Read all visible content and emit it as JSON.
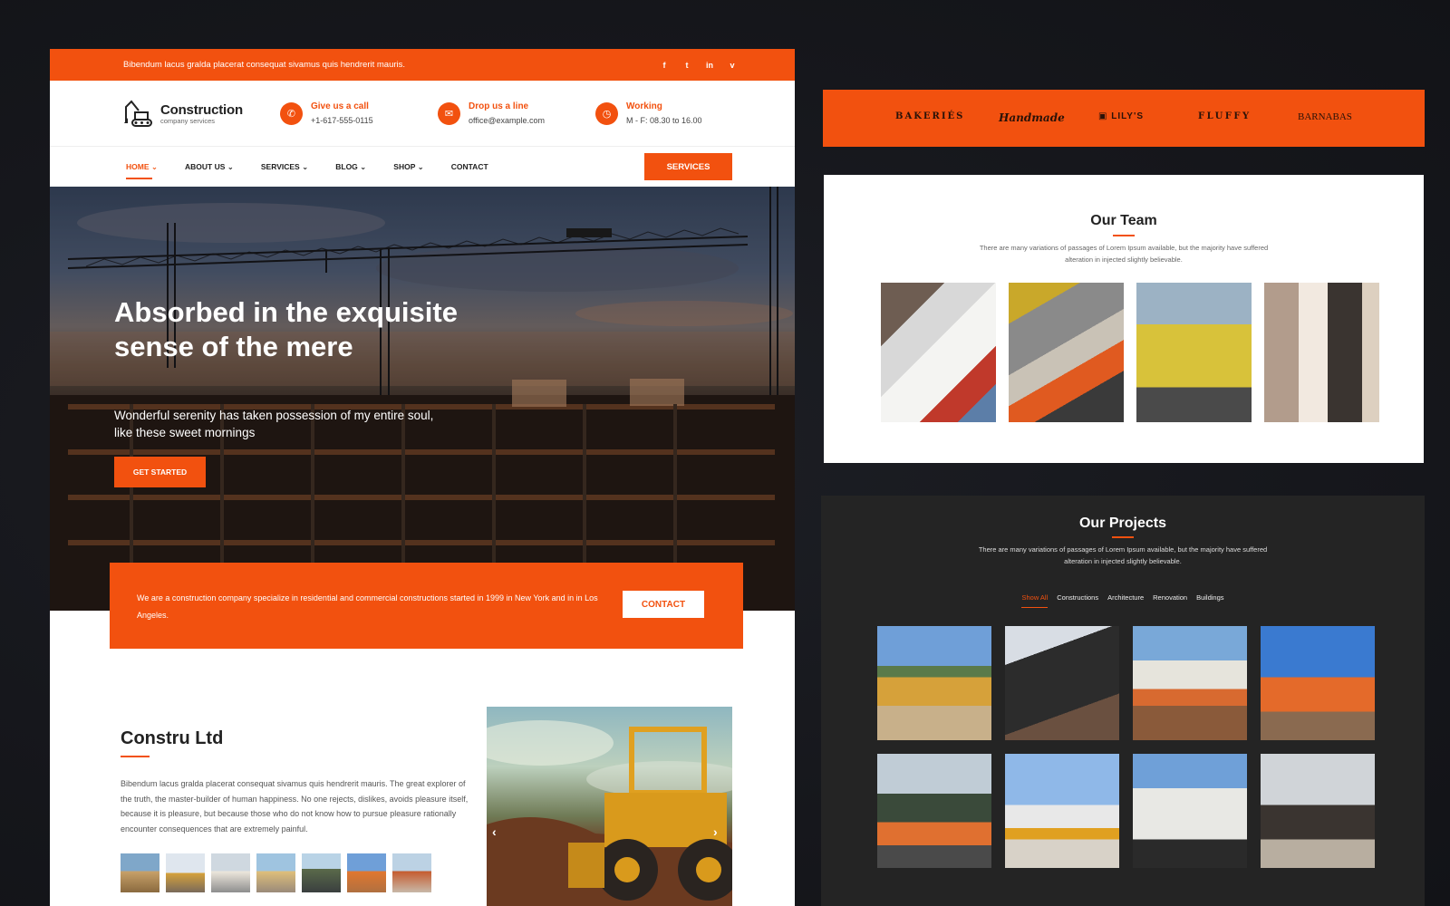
{
  "colors": {
    "accent": "#f2510f",
    "dark_bg": "#16171c",
    "projects_bg": "#242424"
  },
  "topbar": {
    "text": "Bibendum lacus gralda placerat consequat sivamus quis hendrerit mauris.",
    "socials": [
      "f",
      "t",
      "in",
      "v"
    ],
    "social_icons": [
      "facebook-icon",
      "twitter-icon",
      "linkedin-icon",
      "vimeo-icon"
    ]
  },
  "header": {
    "logo_title": "Construction",
    "logo_subtitle": "company services",
    "info": [
      {
        "icon": "phone-icon",
        "label": "Give us a call",
        "value": "+1-617-555-0115"
      },
      {
        "icon": "mail-icon",
        "label": "Drop us a line",
        "value": "office@example.com"
      },
      {
        "icon": "clock-icon",
        "label": "Working",
        "value": "M - F: 08.30 to 16.00"
      }
    ]
  },
  "nav": {
    "items": [
      "HOME",
      "ABOUT US",
      "SERVICES",
      "BLOG",
      "SHOP",
      "CONTACT"
    ],
    "services_button": "SERVICES"
  },
  "hero": {
    "title": "Absorbed in the exquisite sense of the mere",
    "subtitle": "Wonderful serenity has taken possession of my entire soul, like these sweet mornings",
    "button": "GET STARTED"
  },
  "cta": {
    "text": "We are a construction company specialize in residential and commercial constructions  started in 1999 in New York and in in Los Angeles.",
    "button": "CONTACT"
  },
  "about": {
    "title": "Constru Ltd",
    "text": "Bibendum lacus gralda placerat consequat sivamus quis hendrerit mauris. The great explorer of the truth, the master-builder of human happiness. No one rejects, dislikes, avoids pleasure itself, because it is pleasure, but because those who do not know how to pursue pleasure rationally encounter consequences that are extremely painful."
  },
  "brands": [
    "BAKERIÉS",
    "Handmade",
    "LILY'S",
    "FLUFFY",
    "BARNABAS"
  ],
  "team": {
    "title": "Our Team",
    "description": "There are many variations of passages of Lorem Ipsum available, but the majority have suffered alteration in injected slightly believable."
  },
  "projects": {
    "title": "Our Projects",
    "description": "There are many variations of passages of Lorem Ipsum available, but the majority have suffered alteration in injected slightly believable.",
    "filters": [
      "Show All",
      "Constructions",
      "Architecture",
      "Renovation",
      "Buildings"
    ]
  }
}
